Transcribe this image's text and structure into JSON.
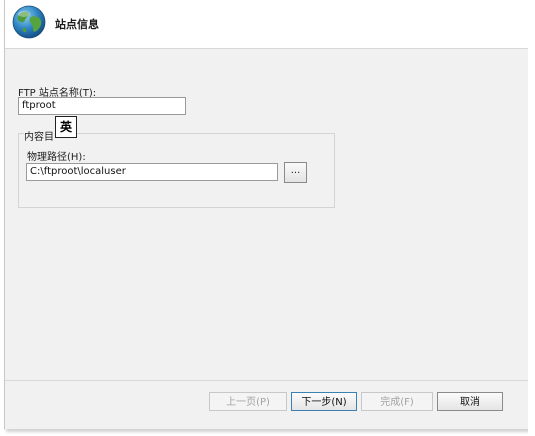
{
  "header": {
    "title": "站点信息",
    "icon": "globe-icon"
  },
  "form": {
    "site_name_label": "FTP 站点名称(T):",
    "site_name_value": "ftproot",
    "content_dir_group_label": "内容目",
    "ime_indicator": "英",
    "physical_path_label": "物理路径(H):",
    "physical_path_value": "C:\\ftproot\\localuser",
    "browse_label": "..."
  },
  "footer": {
    "prev_label": "上一页(P)",
    "next_label": "下一步(N)",
    "finish_label": "完成(F)",
    "cancel_label": "取消"
  },
  "colors": {
    "accent": "#3c7fb1",
    "body_bg": "#f1f1f1"
  }
}
